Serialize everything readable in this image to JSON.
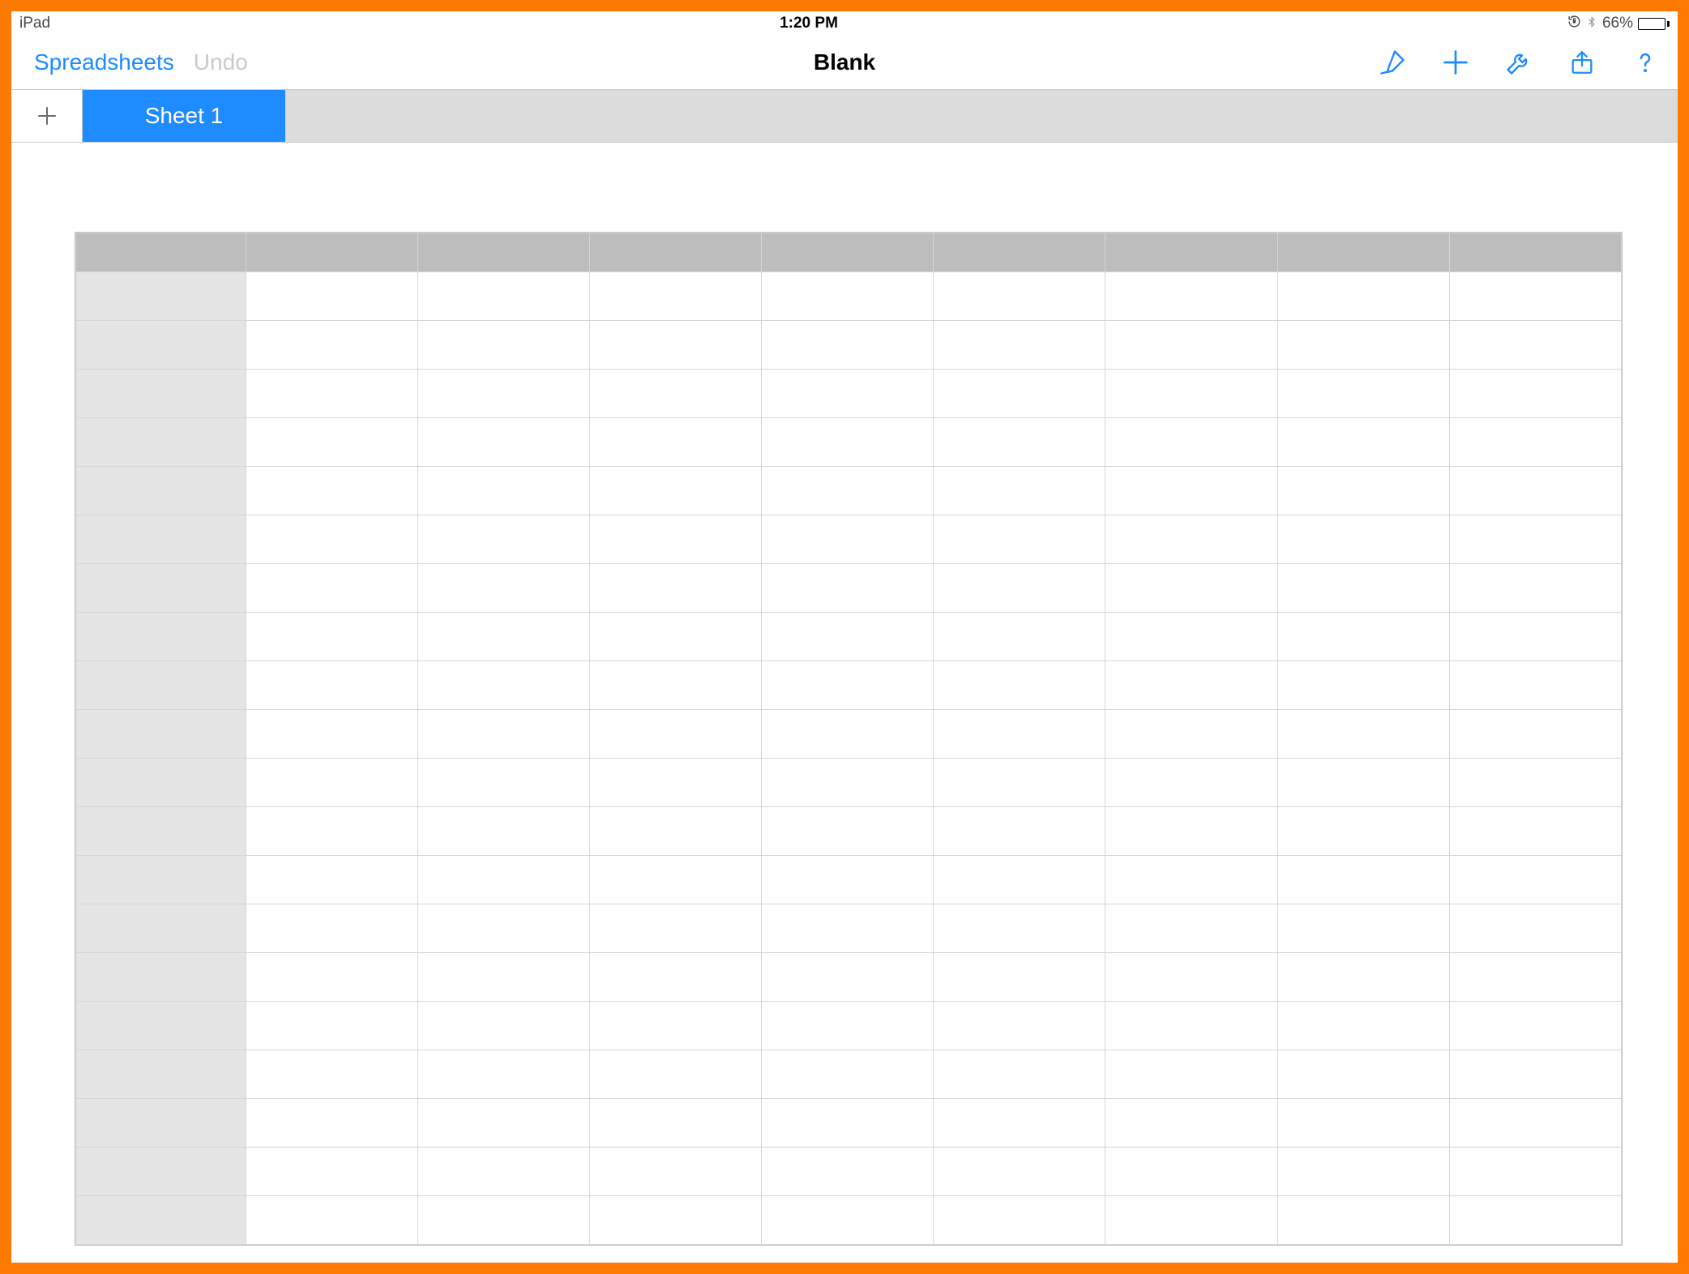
{
  "status": {
    "device": "iPad",
    "time": "1:20 PM",
    "battery_pct": "66%"
  },
  "nav": {
    "back_label": "Spreadsheets",
    "undo_label": "Undo",
    "title": "Blank"
  },
  "tabs": {
    "active_label": "Sheet 1"
  },
  "grid": {
    "columns": 8,
    "rows": 20
  },
  "colors": {
    "accent": "#1e8bff",
    "frame": "#ff7a00"
  }
}
